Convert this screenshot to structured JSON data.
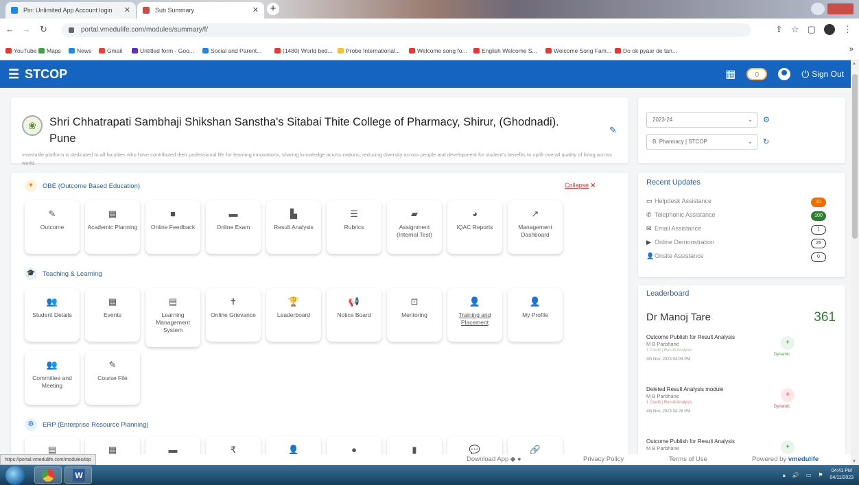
{
  "browser": {
    "tabs": [
      {
        "label": "Pin: Unlimited App Account login"
      },
      {
        "label": "Sub Summary"
      }
    ],
    "new_tab": "+",
    "url": "portal.vmedulife.com/modules/summary/f/",
    "bookmarks": [
      "YouTube",
      "Maps",
      "News",
      "Gmail",
      "Untitled form - Goo...",
      "Social and Parent...",
      "(1480) World bed...",
      "Probe International...",
      "Welcome song fo...",
      "English Welcome S...",
      "Welcome Song Fam...",
      "Do ok pyaar de tan..."
    ]
  },
  "appbar": {
    "brand": "STCOP",
    "badge": "0",
    "signout_label": "Sign Out"
  },
  "college": {
    "name": "Shri Chhatrapati Sambhaji Shikshan Sanstha's Sitabai Thite College of Pharmacy, Shirur, (Ghodnadi). Pune",
    "description": "vmedulife platform is dedicated to all faculties who have contributed their professional life for learning innovations, sharing knowledge across nations, reducing diversity across people and development for student's benefits to uplift overall quality of living across world."
  },
  "selectors": {
    "year": "2023-24",
    "program": "B. Pharmacy | STCOP"
  },
  "obe": {
    "title": "OBE (Outcome Based Education)",
    "collapse_label": "Collapse",
    "tiles": [
      {
        "label": "Outcome",
        "icon": "✎"
      },
      {
        "label": "Academic Planning",
        "icon": "▦"
      },
      {
        "label": "Online Feedback",
        "icon": "■"
      },
      {
        "label": "Online Exam",
        "icon": "▬"
      },
      {
        "label": "Result Analysis",
        "icon": "▙"
      },
      {
        "label": "Rubrics",
        "icon": "☰"
      },
      {
        "label": "Assignment (Internal Test)",
        "icon": "▰"
      },
      {
        "label": "IQAC Reports",
        "icon": "◕"
      },
      {
        "label": "Management Dashboard",
        "icon": "↗"
      }
    ]
  },
  "teaching": {
    "title": "Teaching & Learning",
    "tiles": [
      {
        "label": "Student Details",
        "icon": "👥"
      },
      {
        "label": "Events",
        "icon": "▦"
      },
      {
        "label": "Learning Management System",
        "icon": "▤"
      },
      {
        "label": "Online Grievance",
        "icon": "✝"
      },
      {
        "label": "Leaderboard",
        "icon": "🏆"
      },
      {
        "label": "Notice Board",
        "icon": "📢"
      },
      {
        "label": "Mentoring",
        "icon": "⊡"
      },
      {
        "label": "Training and Placement",
        "icon": "👤"
      },
      {
        "label": "My Profile",
        "icon": "👤"
      },
      {
        "label": "Committee and Meeting",
        "icon": "👥"
      },
      {
        "label": "Course File",
        "icon": "✎"
      }
    ]
  },
  "erp": {
    "title": "ERP (Enterprise Resource Planning)",
    "tiles": [
      {
        "icon": "▤"
      },
      {
        "icon": "▦"
      },
      {
        "icon": "▬"
      },
      {
        "icon": "₹"
      },
      {
        "icon": "👤"
      },
      {
        "icon": "●"
      },
      {
        "icon": "▮"
      },
      {
        "icon": "💬"
      },
      {
        "icon": "🔗"
      }
    ]
  },
  "recent_updates": {
    "title": "Recent Updates",
    "items": [
      {
        "label": "Helpdesk Assistance",
        "count": "10",
        "icon": "▭"
      },
      {
        "label": "Telephonic Assistance",
        "count": "100",
        "icon": "✆"
      },
      {
        "label": "Email Assistance",
        "count": "1",
        "icon": "✉"
      },
      {
        "label": "Online Demonstration",
        "count": "26",
        "icon": "▶"
      },
      {
        "label": "Onsite Assistance",
        "count": "0",
        "icon": "👤"
      }
    ]
  },
  "leaderboard": {
    "title": "Leaderboard",
    "name": "Dr Manoj Tare",
    "score": "361",
    "activities": [
      {
        "title": "Outcome Publish for Result Analysis",
        "person": "M B Parbhane",
        "module": "1 Credit | Result Analysis",
        "date": "4th Nov, 2023 04:04 PM",
        "dot": "+",
        "dot_label": "Dynamic"
      },
      {
        "title": "Deleted Result Analysis module",
        "person": "M B Parbhane",
        "module": "1 Credit | Result Analysis",
        "date": "4th Nov, 2023 04:28 PM",
        "dot": "+",
        "dot_label": "Dynamic"
      },
      {
        "title": "Outcome Publish for Result Analysis",
        "person": "M B Parbhane",
        "module": "",
        "date": "",
        "dot": "+",
        "dot_label": ""
      }
    ]
  },
  "footer": {
    "status_url": "https://portal.vmedulife.com/modules/top",
    "download": "Download App",
    "privacy": "Privacy Policy",
    "terms": "Terms of Use",
    "powered": "Powered by",
    "powered_brand": "vmedulife"
  },
  "taskbar": {
    "time": "04:41 PM",
    "date": "04/11/2023"
  }
}
